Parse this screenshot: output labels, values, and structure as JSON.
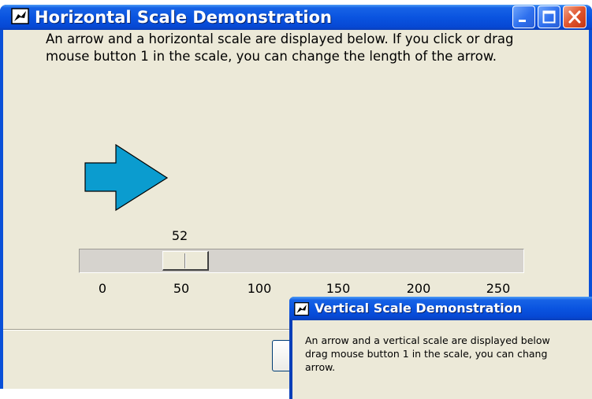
{
  "main_window": {
    "title": "Horizontal Scale Demonstration",
    "icon": "tk-feather-icon",
    "description": "An arrow and a horizontal scale are displayed below.  If you click or drag mouse button 1 in the scale, you can change the length of the arrow.",
    "arrow_color": "#0b9ccf",
    "scale": {
      "value": "52",
      "min": 0,
      "max": 250,
      "current_value": 52,
      "ticks": [
        "0",
        "50",
        "100",
        "150",
        "200",
        "250"
      ]
    }
  },
  "second_window": {
    "title": "Vertical Scale Demonstration",
    "icon": "tk-feather-icon",
    "description_lines": [
      "An arrow and a vertical scale are displayed below",
      "drag mouse button 1 in the scale, you can chang",
      "arrow."
    ]
  },
  "colors": {
    "titlebar": "#0a54e0",
    "close_button": "#e0552d",
    "window_bg": "#ece9d8",
    "trough": "#d6d3ce"
  }
}
